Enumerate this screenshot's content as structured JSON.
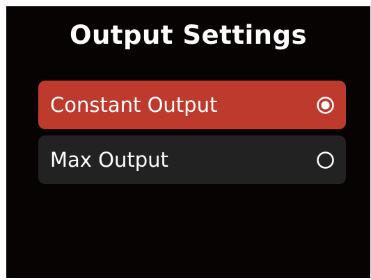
{
  "screen": {
    "title": "Output Settings"
  },
  "options": [
    {
      "label": "Constant Output",
      "selected": true
    },
    {
      "label": "Max Output",
      "selected": false
    }
  ],
  "colors": {
    "background": "#080303",
    "selected_row": "#BE3A2D",
    "unselected_row": "#222222",
    "text": "#FFFFFF"
  },
  "icons": {
    "selected": "radio-selected-icon",
    "unselected": "radio-unselected-icon"
  }
}
